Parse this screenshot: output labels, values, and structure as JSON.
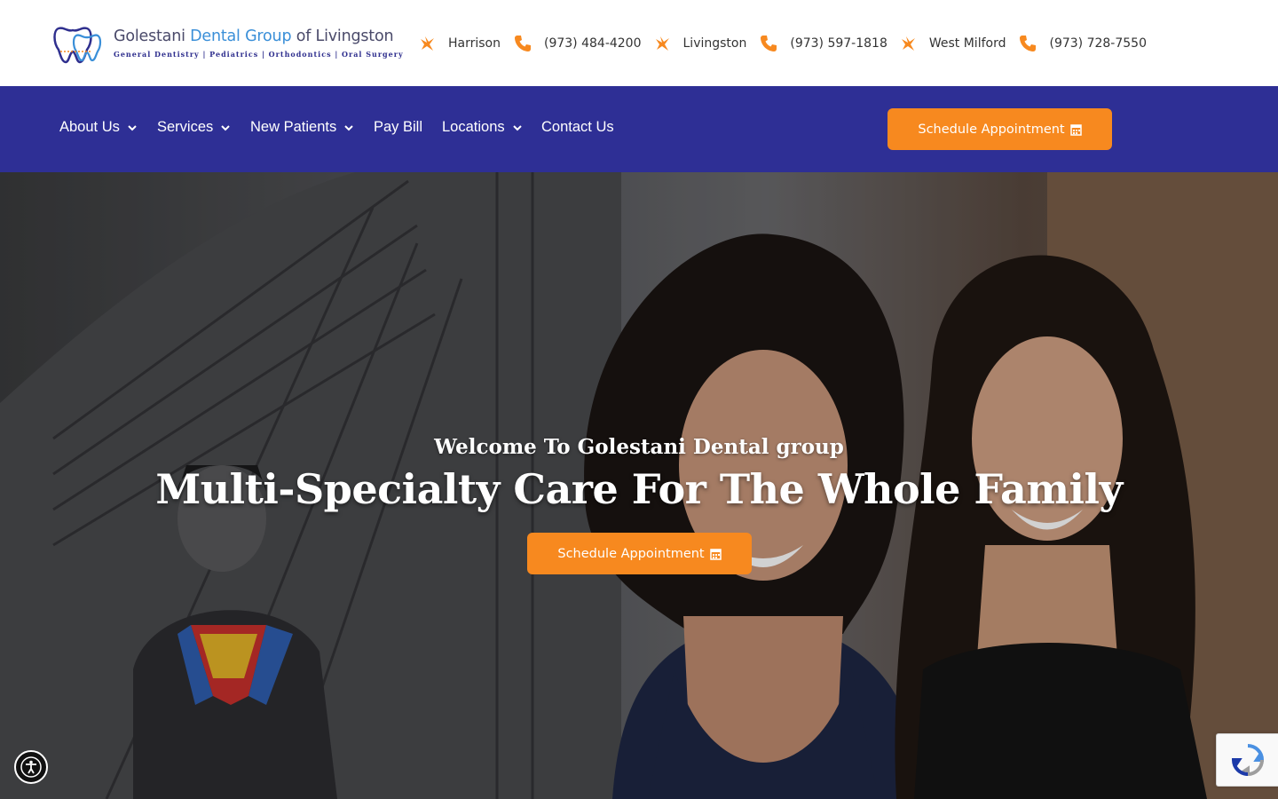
{
  "brand": {
    "title_part1": "Golestani ",
    "title_part2": "Dental Group",
    "title_part3": " of Livingston",
    "tagline": "General Dentistry | Pediatrics | Orthodontics | Oral Surgery"
  },
  "locations": [
    {
      "name": "Harrison",
      "phone": "(973) 484-4200"
    },
    {
      "name": "Livingston",
      "phone": "(973) 597-1818"
    },
    {
      "name": "West Milford",
      "phone": "(973) 728-7550"
    }
  ],
  "nav": {
    "items": [
      {
        "label": "About Us",
        "has_dropdown": true
      },
      {
        "label": "Services",
        "has_dropdown": true
      },
      {
        "label": "New Patients",
        "has_dropdown": true
      },
      {
        "label": "Pay Bill",
        "has_dropdown": false
      },
      {
        "label": "Locations",
        "has_dropdown": true
      },
      {
        "label": "Contact Us",
        "has_dropdown": false
      }
    ],
    "cta_label": "Schedule Appointment"
  },
  "hero": {
    "welcome": "Welcome To Golestani Dental group",
    "title": "Multi-Specialty Care For The Whole Family",
    "cta_label": "Schedule Appointment"
  },
  "icons": {
    "location": "map-pin-icon",
    "phone": "phone-icon",
    "dropdown": "chevron-down-icon",
    "calendar": "calendar-icon",
    "accessibility": "accessibility-icon",
    "recaptcha": "recaptcha-icon"
  },
  "colors": {
    "nav_bg": "#2e2f95",
    "accent_orange": "#f7891f",
    "brand_blue": "#3a8fd8",
    "text_dark": "#333333"
  }
}
